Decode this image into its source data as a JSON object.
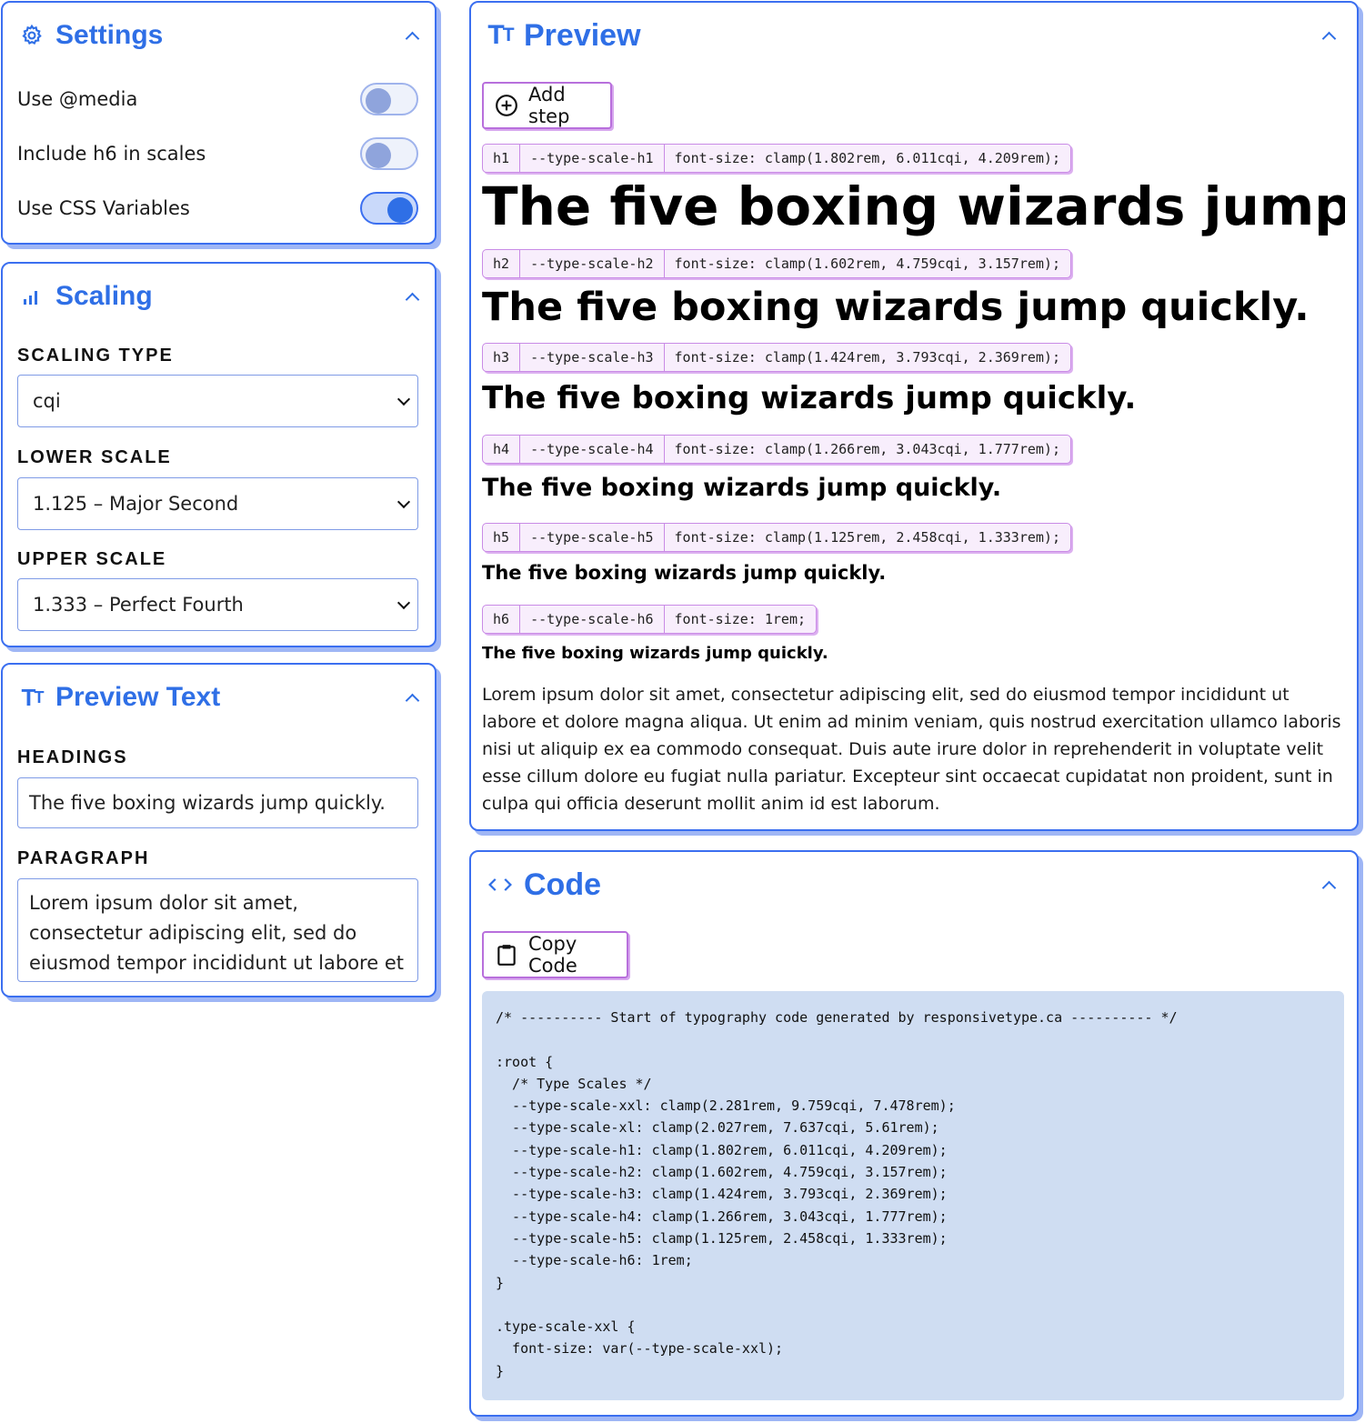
{
  "settings": {
    "title": "Settings",
    "icon": "gear-icon",
    "toggles": [
      {
        "label": "Use @media",
        "on": false
      },
      {
        "label": "Include h6 in scales",
        "on": false
      },
      {
        "label": "Use CSS Variables",
        "on": true
      }
    ]
  },
  "scaling": {
    "title": "Scaling",
    "icon": "bars-icon",
    "type_label": "SCALING TYPE",
    "type_value": "cqi",
    "lower_label": "LOWER SCALE",
    "lower_value": "1.125 – Major Second",
    "upper_label": "UPPER SCALE",
    "upper_value": "1.333 – Perfect Fourth"
  },
  "preview_text": {
    "title": "Preview Text",
    "icon": "text-size-icon",
    "headings_label": "HEADINGS",
    "headings_value": "The five boxing wizards jump quickly.",
    "paragraph_label": "PARAGRAPH",
    "paragraph_value": "Lorem ipsum dolor sit amet, consectetur adipiscing elit, sed do eiusmod tempor incididunt ut labore et dolore magna"
  },
  "preview": {
    "title": "Preview",
    "icon": "text-size-icon",
    "add_step_label": "Add step",
    "sample_text": "The five boxing wizards jump quickly.",
    "steps": [
      {
        "tag": "h1",
        "var": "--type-scale-h1",
        "rule": "font-size: clamp(1.802rem, 6.011cqi, 4.209rem);"
      },
      {
        "tag": "h2",
        "var": "--type-scale-h2",
        "rule": "font-size: clamp(1.602rem, 4.759cqi, 3.157rem);"
      },
      {
        "tag": "h3",
        "var": "--type-scale-h3",
        "rule": "font-size: clamp(1.424rem, 3.793cqi, 2.369rem);"
      },
      {
        "tag": "h4",
        "var": "--type-scale-h4",
        "rule": "font-size: clamp(1.266rem, 3.043cqi, 1.777rem);"
      },
      {
        "tag": "h5",
        "var": "--type-scale-h5",
        "rule": "font-size: clamp(1.125rem, 2.458cqi, 1.333rem);"
      },
      {
        "tag": "h6",
        "var": "--type-scale-h6",
        "rule": "font-size: 1rem;"
      }
    ],
    "paragraph": "Lorem ipsum dolor sit amet, consectetur adipiscing elit, sed do eiusmod tempor incididunt ut labore et dolore magna aliqua. Ut enim ad minim veniam, quis nostrud exercitation ullamco laboris nisi ut aliquip ex ea commodo consequat. Duis aute irure dolor in reprehenderit in voluptate velit esse cillum dolore eu fugiat nulla pariatur. Excepteur sint occaecat cupidatat non proident, sunt in culpa qui officia deserunt mollit anim id est laborum."
  },
  "code": {
    "title": "Code",
    "icon": "code-icon",
    "copy_label": "Copy Code",
    "content": "/* ---------- Start of typography code generated by responsivetype.ca ---------- */\n\n:root {\n  /* Type Scales */\n  --type-scale-xxl: clamp(2.281rem, 9.759cqi, 7.478rem);\n  --type-scale-xl: clamp(2.027rem, 7.637cqi, 5.61rem);\n  --type-scale-h1: clamp(1.802rem, 6.011cqi, 4.209rem);\n  --type-scale-h2: clamp(1.602rem, 4.759cqi, 3.157rem);\n  --type-scale-h3: clamp(1.424rem, 3.793cqi, 2.369rem);\n  --type-scale-h4: clamp(1.266rem, 3.043cqi, 1.777rem);\n  --type-scale-h5: clamp(1.125rem, 2.458cqi, 1.333rem);\n  --type-scale-h6: 1rem;\n}\n\n.type-scale-xxl {\n  font-size: var(--type-scale-xxl);\n}"
  },
  "colors": {
    "accent": "#2f6fe6",
    "chip_border": "#c98be6",
    "code_bg": "#cfddf2"
  }
}
